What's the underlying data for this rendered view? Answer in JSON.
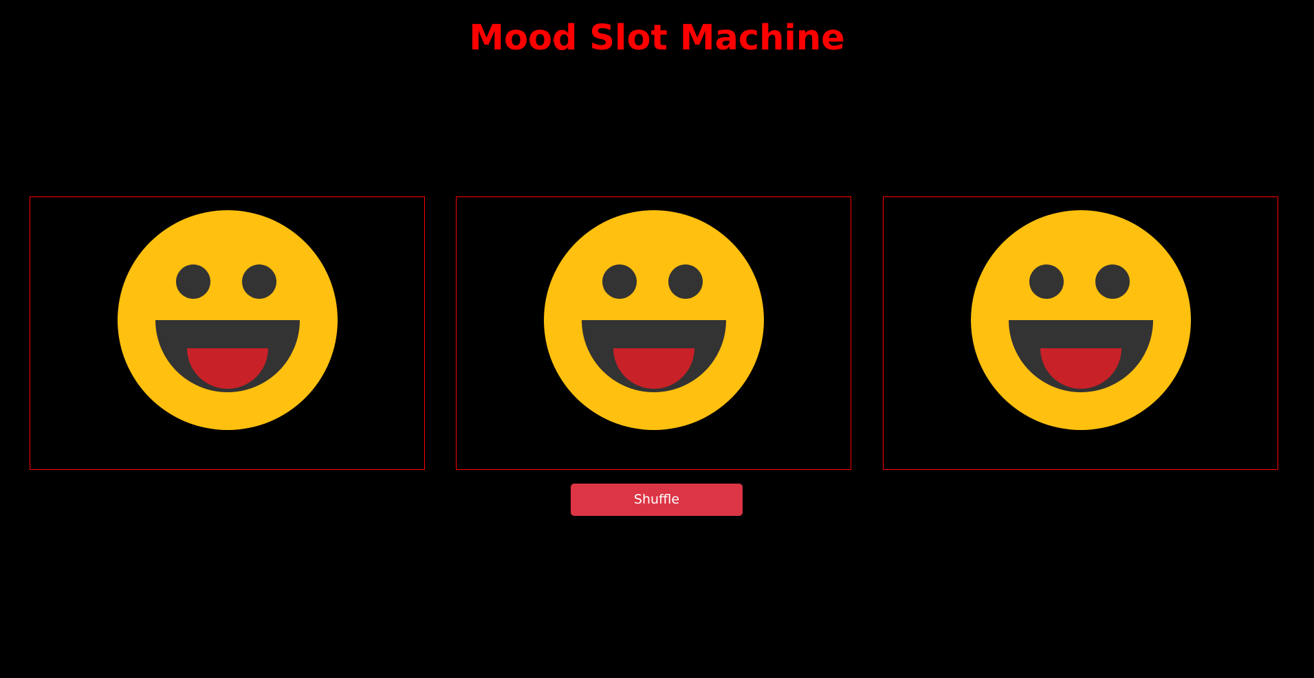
{
  "header": {
    "title": "Mood Slot Machine"
  },
  "slots": [
    {
      "icon": "grinning-face-icon"
    },
    {
      "icon": "grinning-face-icon"
    },
    {
      "icon": "grinning-face-icon"
    }
  ],
  "controls": {
    "shuffle_label": "Shuffle"
  },
  "colors": {
    "background": "#000000",
    "accent": "#ff0000",
    "button": "#dc3545",
    "face": "#ffc00f",
    "features": "#333333",
    "tongue": "#c82128"
  }
}
